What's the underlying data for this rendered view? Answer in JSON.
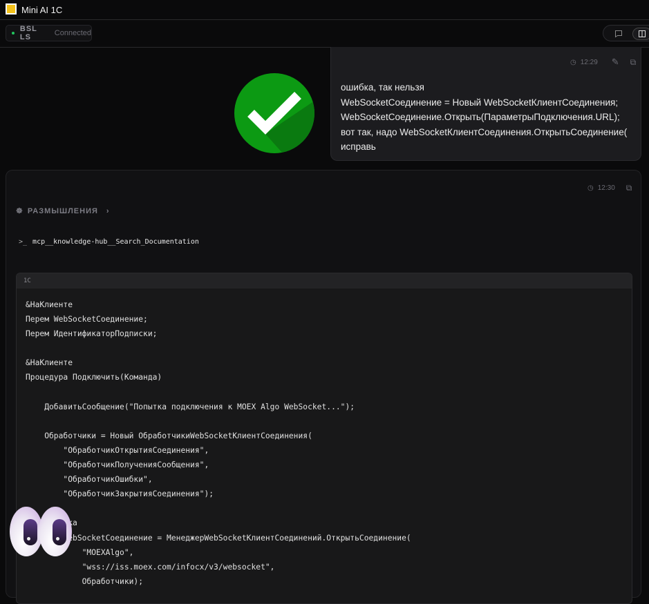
{
  "app": {
    "title": "Mini AI 1C",
    "logo_text": "1C"
  },
  "status": {
    "name": "BSL LS",
    "state": "Connected",
    "color": "#22c55e"
  },
  "user_message": {
    "time": "12:29",
    "lines": [
      "ошибка, так нельзя",
      "WebSocketСоединение = Новый WebSocketКлиентСоединения;",
      "WebSocketСоединение.Открыть(ПараметрыПодключения.URL);",
      "вот так, надо WebSocketКлиентСоединения.ОткрытьСоединение(",
      "исправь"
    ]
  },
  "assistant_message": {
    "time": "12:30",
    "thinking_label": "РАЗМЫШЛЕНИЯ",
    "tool_call": "mcp__knowledge-hub__Search_Documentation",
    "code_language": "1C",
    "code_lines": [
      "&НаКлиенте",
      "Перем WebSocketСоединение;",
      "Перем ИдентификаторПодписки;",
      "",
      "&НаКлиенте",
      "Процедура Подключить(Команда)",
      "",
      "    ДобавитьСообщение(\"Попытка подключения к MOEX Algo WebSocket...\");",
      "",
      "    Обработчики = Новый ОбработчикиWebSocketКлиентСоединения(",
      "        \"ОбработчикОткрытияСоединения\",",
      "        \"ОбработчикПолученияСообщения\",",
      "        \"ОбработчикОшибки\",",
      "        \"ОбработчикЗакрытияСоединения\");",
      "",
      "    Попытка",
      "        WebSocketСоединение = МенеджерWebSocketКлиентСоединений.ОткрытьСоединение(",
      "            \"MOEXAlgo\",",
      "            \"wss://iss.moex.com/infocx/v3/websocket\",",
      "            Обработчики);"
    ]
  }
}
